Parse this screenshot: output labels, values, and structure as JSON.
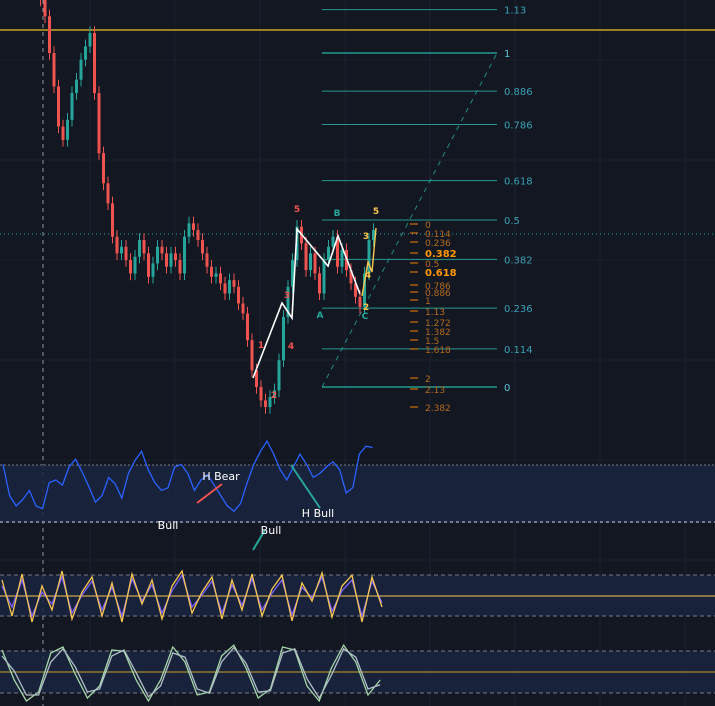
{
  "chart_data": [
    {
      "type": "candlestick",
      "panel": "price",
      "title": "",
      "xlabel": "",
      "ylabel": "",
      "colors": {
        "up": "#26a69a",
        "down": "#ef5350",
        "background": "#131722"
      },
      "candles_close": [
        1.28,
        1.16,
        1.11,
        1.0,
        0.9,
        0.78,
        0.74,
        0.8,
        0.88,
        0.92,
        0.98,
        1.02,
        1.06,
        0.88,
        0.7,
        0.61,
        0.55,
        0.45,
        0.4,
        0.42,
        0.38,
        0.34,
        0.39,
        0.44,
        0.4,
        0.33,
        0.37,
        0.42,
        0.4,
        0.36,
        0.4,
        0.38,
        0.34,
        0.45,
        0.49,
        0.47,
        0.44,
        0.4,
        0.36,
        0.33,
        0.34,
        0.31,
        0.28,
        0.32,
        0.3,
        0.25,
        0.22,
        0.14,
        0.05,
        0.0,
        -0.04,
        -0.06,
        -0.03,
        -0.01,
        0.08,
        0.21,
        0.3,
        0.38,
        0.48,
        0.43,
        0.35,
        0.4,
        0.34,
        0.28,
        0.38,
        0.42,
        0.45,
        0.36,
        0.41,
        0.35,
        0.31,
        0.27,
        0.24,
        0.34,
        0.44,
        0.47
      ],
      "fib_retracement": {
        "levels": [
          "1.13",
          "1",
          "0.886",
          "0.786",
          "0.618",
          "0.5",
          "0.382",
          "0.236",
          "0.114",
          "0"
        ],
        "values": [
          1.13,
          1,
          0.886,
          0.786,
          0.618,
          0.5,
          0.382,
          0.236,
          0.114,
          0
        ],
        "color": "#26a69a"
      },
      "fib_extension": {
        "levels": [
          "0",
          "0.114",
          "0.236",
          "0.382",
          "0.5",
          "0.618",
          "0.786",
          "0.886",
          "1",
          "1.13",
          "1.272",
          "1.382",
          "1.5",
          "1.618",
          "2",
          "2.13",
          "2.382"
        ],
        "values": [
          0.5,
          0.45,
          0.42,
          0.38,
          0.345,
          0.31,
          0.26,
          0.235,
          0.2,
          0.165,
          0.125,
          0.09,
          0.055,
          0.02,
          -0.1,
          -0.135,
          -0.205
        ],
        "highlighted": [
          "0.382",
          "0.618"
        ],
        "color": "#f57c00"
      },
      "wave_labels": [
        {
          "text": "1",
          "color": "#ef5350",
          "x_index": 51,
          "value": 0.08
        },
        {
          "text": "2",
          "color": "#ef5350",
          "x_index": 53,
          "value": -0.13
        },
        {
          "text": "3",
          "color": "#ef5350",
          "x_index": 55,
          "value": 0.08
        },
        {
          "text": "4",
          "color": "#ef5350",
          "x_index": 57,
          "value": 0.04
        },
        {
          "text": "5",
          "color": "#ef5350",
          "x_index": 58,
          "value": 0.53
        },
        {
          "text": "A",
          "color": "#26a69a",
          "x_index": 62,
          "value": 0.22
        },
        {
          "text": "B",
          "color": "#26a69a",
          "x_index": 66,
          "value": 0.51
        },
        {
          "text": "C",
          "color": "#26a69a",
          "x_index": 71,
          "value": 0.21
        },
        {
          "text": "5",
          "color": "#f9c74f",
          "x_index": 74,
          "value": 0.51
        },
        {
          "text": "3",
          "color": "#f9c74f",
          "x_index": 72,
          "value": 0.44
        },
        {
          "text": "4",
          "color": "#f9c74f",
          "x_index": 72,
          "value": 0.31
        },
        {
          "text": "2",
          "color": "#f9c74f",
          "x_index": 71,
          "value": 0.23
        }
      ]
    },
    {
      "type": "line",
      "panel": "rsi",
      "series": [
        {
          "color": "#2962ff",
          "values": [
            62,
            38,
            30,
            35,
            42,
            30,
            28,
            48,
            50,
            46,
            60,
            66,
            56,
            45,
            33,
            38,
            52,
            47,
            36,
            55,
            65,
            72,
            58,
            48,
            42,
            44,
            60,
            62,
            55,
            42,
            50,
            54,
            46,
            38,
            30,
            26,
            32,
            48,
            62,
            72,
            80,
            70,
            58,
            50,
            60,
            70,
            62,
            52,
            55,
            60,
            64,
            58,
            40,
            44,
            70,
            76,
            75
          ]
        }
      ],
      "annotations": [
        {
          "text": "H Bear",
          "color": "#ffffff"
        },
        {
          "text": "Bull",
          "color": "#ffffff"
        },
        {
          "text": "Bull",
          "color": "#ffffff"
        },
        {
          "text": "H Bull",
          "color": "#ffffff"
        }
      ]
    },
    {
      "type": "line",
      "panel": "stochastic",
      "series": [
        {
          "color": "#f9c74f",
          "values": [
            80,
            20,
            90,
            10,
            70,
            30,
            95,
            15,
            60,
            85,
            20,
            75,
            10,
            90,
            40,
            80,
            15,
            70,
            95,
            25,
            60,
            85,
            15,
            80,
            30,
            90,
            20,
            65,
            88,
            12,
            75,
            45,
            92,
            18,
            70,
            88,
            10,
            85,
            35
          ]
        },
        {
          "color": "#7b61ff",
          "values": [
            70,
            35,
            80,
            20,
            60,
            40,
            85,
            25,
            55,
            78,
            30,
            68,
            20,
            82,
            45,
            72,
            25,
            62,
            88,
            35,
            55,
            78,
            25,
            72,
            38,
            82,
            30,
            58,
            80,
            22,
            68,
            50,
            85,
            28,
            62,
            80,
            20,
            78,
            42
          ]
        }
      ]
    },
    {
      "type": "line",
      "panel": "stoch_rsi",
      "series": [
        {
          "color": "#a5d6a7",
          "values": [
            90,
            40,
            5,
            20,
            85,
            95,
            50,
            10,
            30,
            90,
            88,
            40,
            5,
            40,
            95,
            70,
            15,
            20,
            80,
            98,
            60,
            10,
            25,
            95,
            90,
            30,
            5,
            60,
            98,
            70,
            15,
            40
          ]
        },
        {
          "color": "#b0bec5",
          "values": [
            80,
            55,
            15,
            15,
            70,
            92,
            62,
            20,
            25,
            80,
            90,
            52,
            12,
            30,
            85,
            78,
            25,
            18,
            70,
            94,
            68,
            20,
            22,
            85,
            92,
            42,
            10,
            48,
            92,
            78,
            25,
            32
          ]
        }
      ]
    }
  ]
}
